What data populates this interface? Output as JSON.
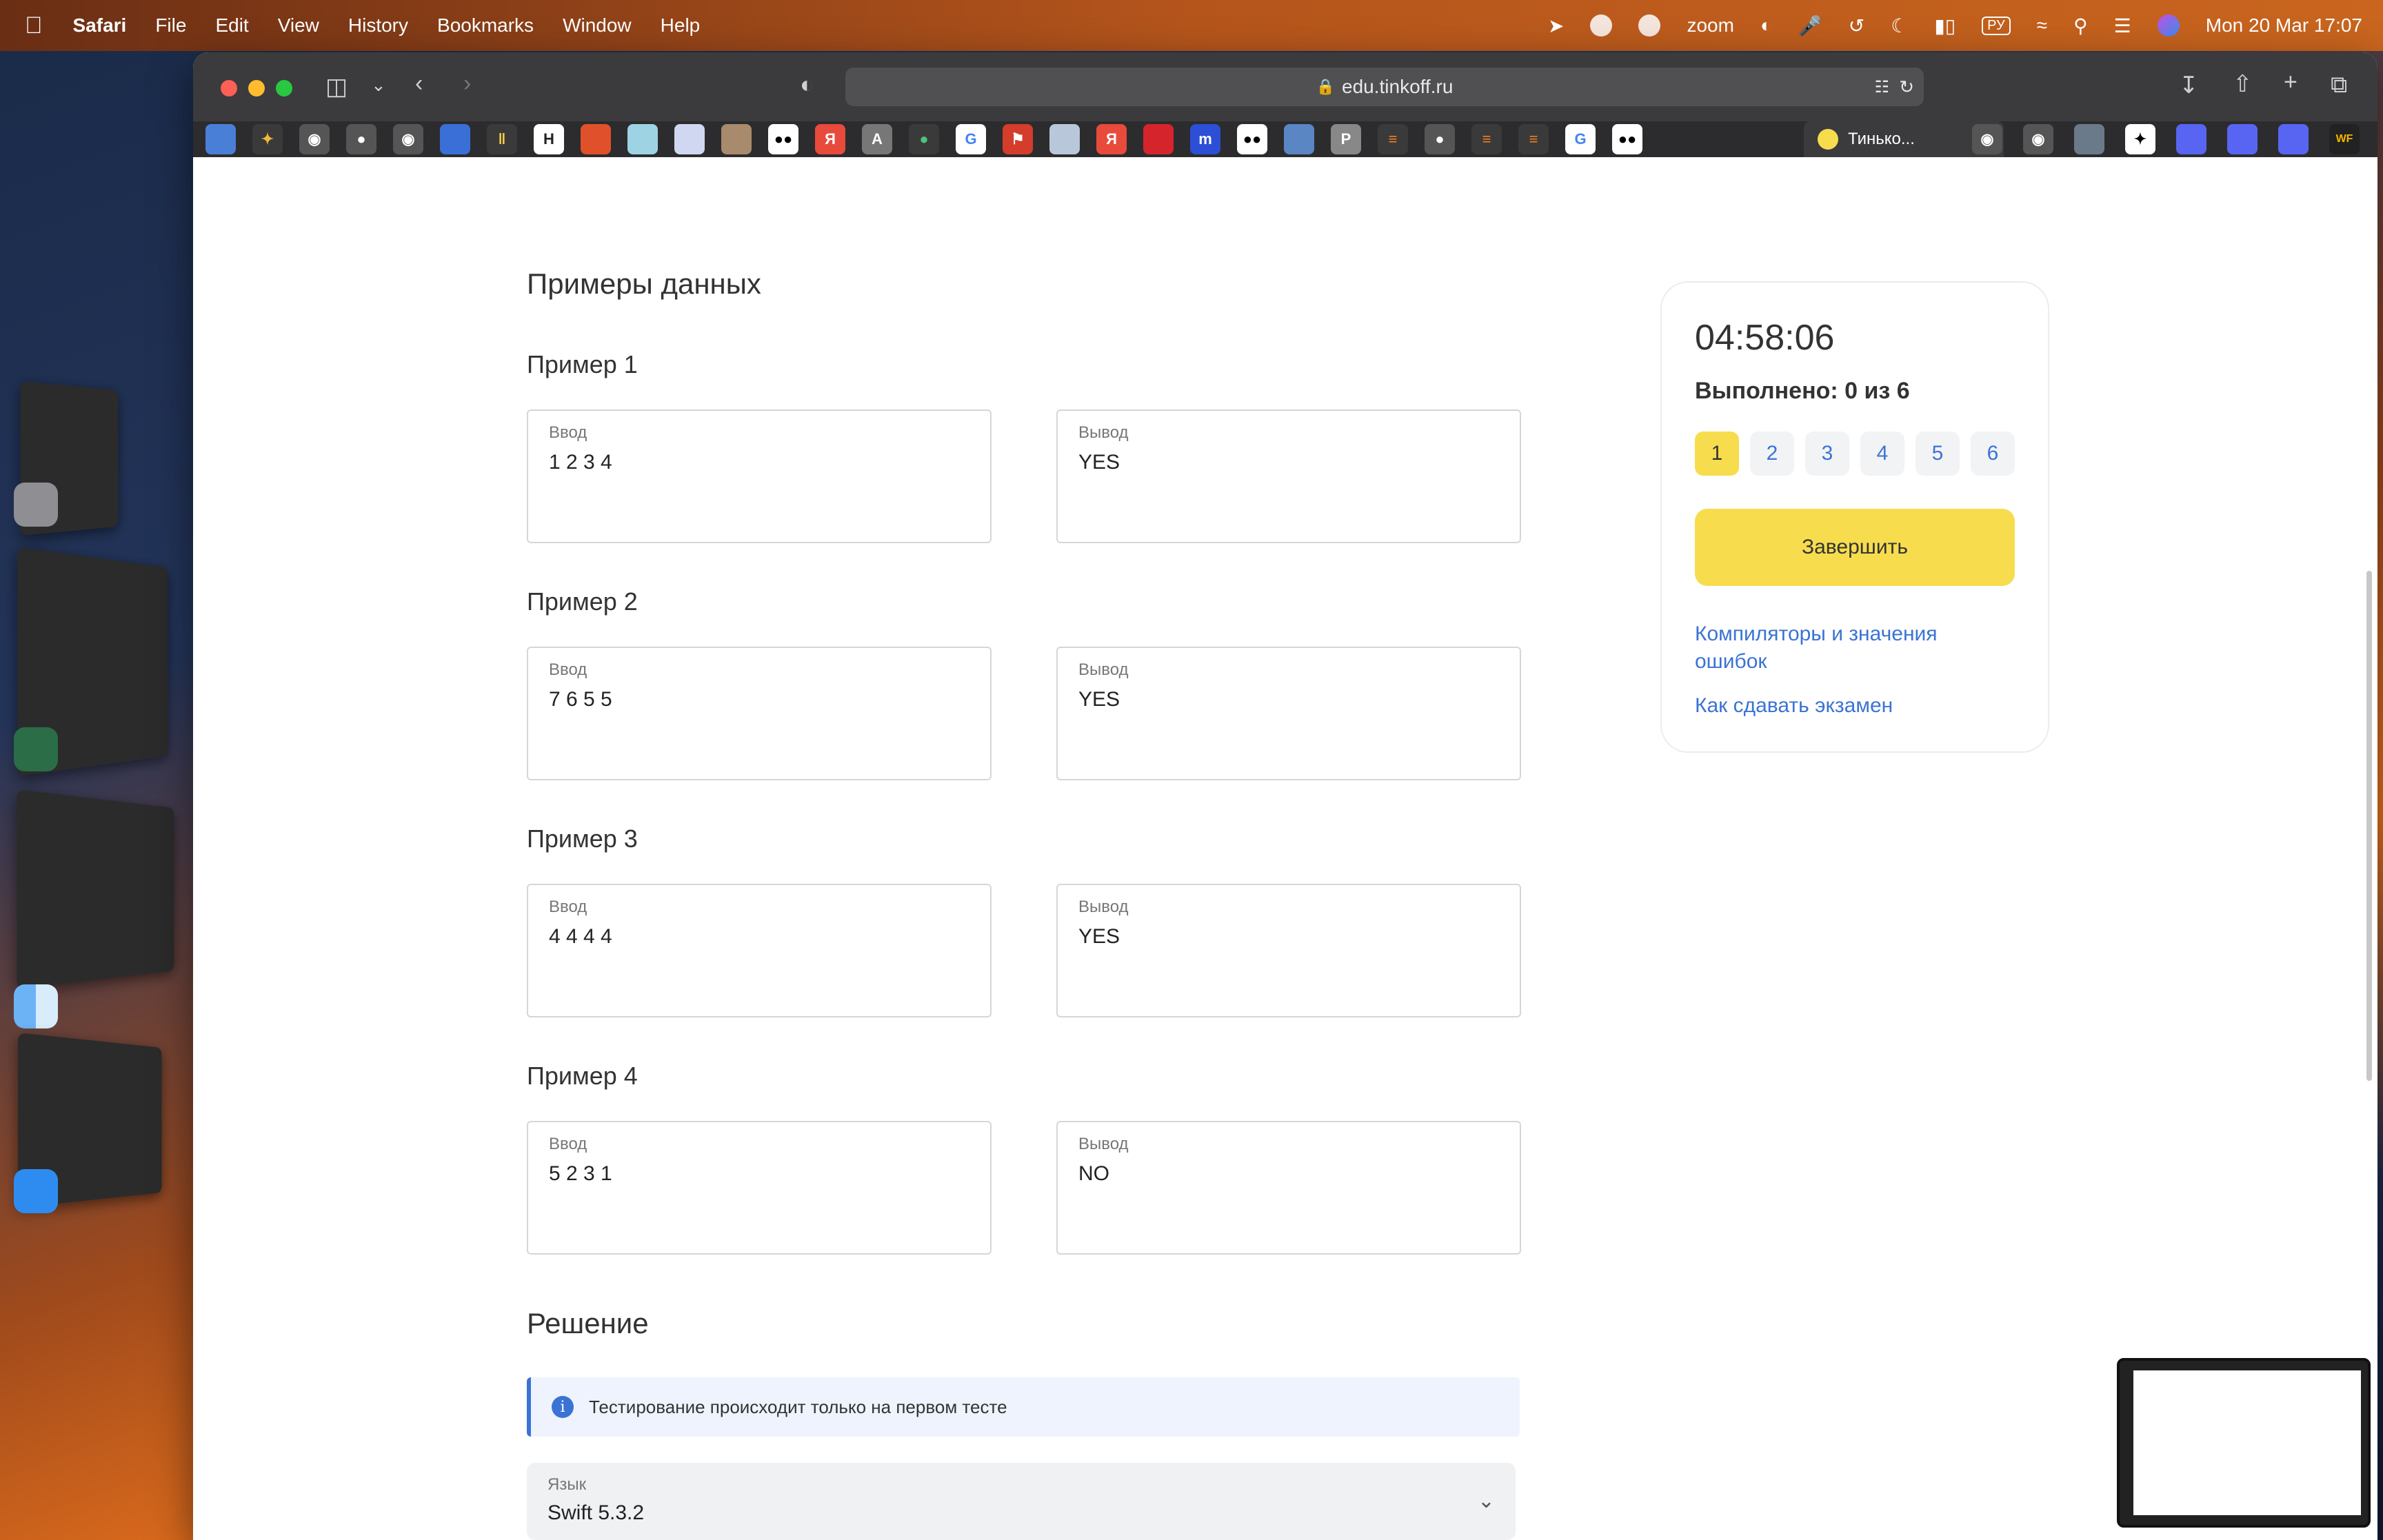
{
  "menubar": {
    "apple": "",
    "app_name": "Safari",
    "items": [
      "File",
      "Edit",
      "View",
      "History",
      "Bookmarks",
      "Window",
      "Help"
    ],
    "zoom_label": "zoom",
    "keyboard_layout": "РУ",
    "clock": "Mon 20 Mar  17:07"
  },
  "browser": {
    "url": "edu.tinkoff.ru",
    "active_tab_title": "Тинько...",
    "favorite_labels": [
      "Я",
      "A",
      "Я",
      "m",
      "P",
      "WF"
    ]
  },
  "page": {
    "data_examples_title": "Примеры данных",
    "input_label": "Ввод",
    "output_label": "Вывод",
    "examples": [
      {
        "title": "Пример 1",
        "input": "1 2 3 4",
        "output": "YES"
      },
      {
        "title": "Пример 2",
        "input": "7 6 5 5",
        "output": "YES"
      },
      {
        "title": "Пример 3",
        "input": "4 4 4 4",
        "output": "YES"
      },
      {
        "title": "Пример 4",
        "input": "5 2 3 1",
        "output": "NO"
      }
    ],
    "solution_title": "Решение",
    "notice_icon": "i",
    "notice_text": "Тестирование происходит только на первом тесте",
    "language_label": "Язык",
    "language_value": "Swift 5.3.2"
  },
  "panel": {
    "timer": "04:58:06",
    "progress": "Выполнено: 0 из 6",
    "task_numbers": [
      "1",
      "2",
      "3",
      "4",
      "5",
      "6"
    ],
    "current_task": "1",
    "finish_button": "Завершить",
    "compilers_link": "Компиляторы и значения ошибок",
    "exam_link": "Как сдавать экзамен"
  },
  "colors": {
    "accent_yellow": "#f7dc4e",
    "link_blue": "#3b73d4"
  }
}
